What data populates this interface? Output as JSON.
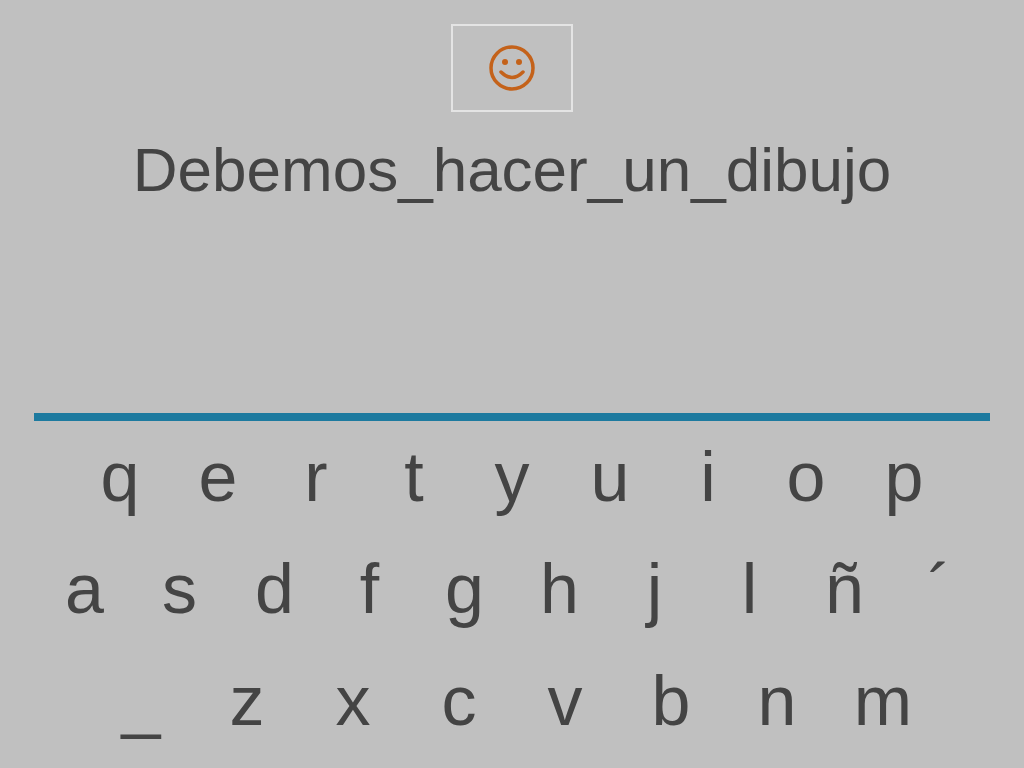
{
  "sentence": "Debemos_hacer_un_dibujo",
  "keyboard": {
    "rows": [
      [
        "q",
        "e",
        "r",
        "t",
        "y",
        "u",
        "i",
        "o",
        "p"
      ],
      [
        "a",
        "s",
        "d",
        "f",
        "g",
        "h",
        "j",
        "l",
        "ñ",
        "´"
      ],
      [
        "_",
        "z",
        "x",
        "c",
        "v",
        "b",
        "n",
        "m"
      ]
    ]
  }
}
